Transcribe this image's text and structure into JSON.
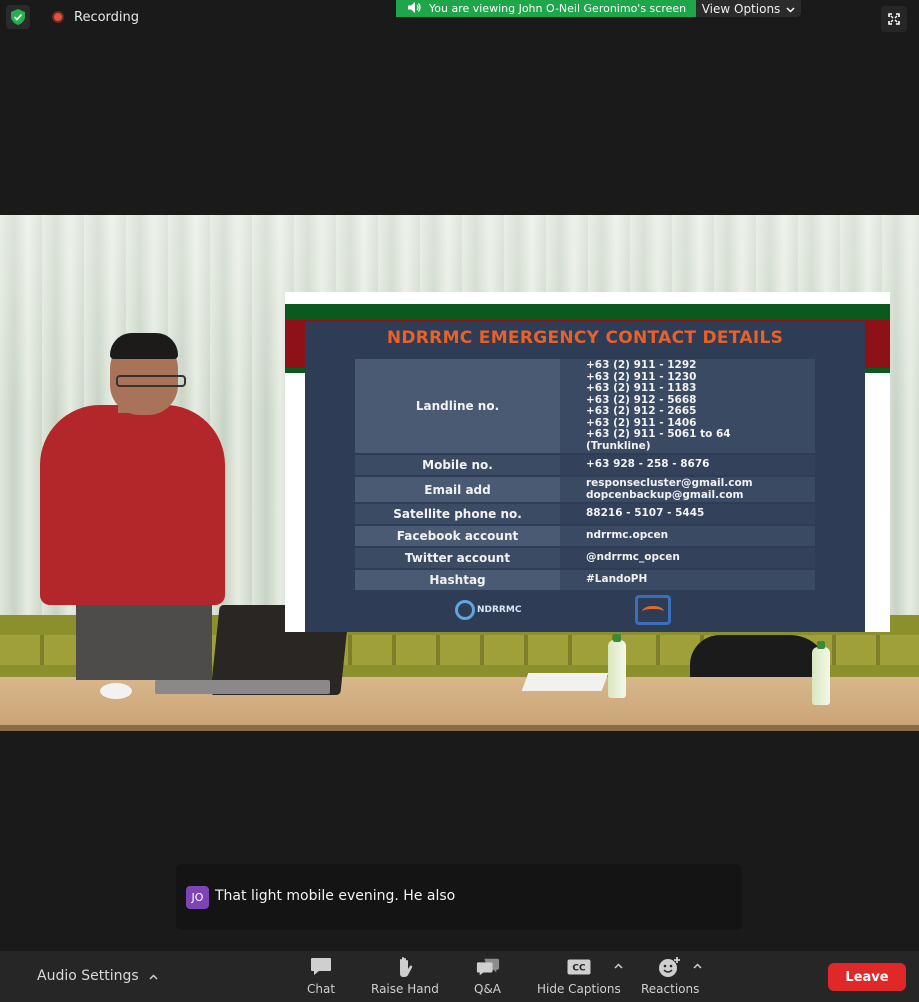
{
  "top_bar": {
    "recording_label": "Recording",
    "banner_text": "You are viewing John O-Neil Geronimo's screen",
    "view_options_label": "View Options",
    "colors": {
      "banner": "#1fa54a",
      "record_dot": "#e2533c",
      "shield": "#22b14c"
    }
  },
  "slide": {
    "title": "NDRRMC EMERGENCY CONTACT DETAILS",
    "rows": [
      {
        "label": "Landline no.",
        "values": [
          "+63 (2) 911 - 1292",
          "+63 (2) 911 - 1230",
          "+63 (2) 911 - 1183",
          "+63 (2) 912 - 5668",
          "+63 (2) 912 - 2665",
          "+63 (2) 911 - 1406",
          "+63 (2) 911 - 5061 to 64",
          "(Trunkline)"
        ]
      },
      {
        "label": "Mobile no.",
        "values": [
          "+63 928 - 258 - 8676"
        ]
      },
      {
        "label": "Email add",
        "values": [
          "responsecluster@gmail.com",
          "dopcenbackup@gmail.com"
        ]
      },
      {
        "label": "Satellite phone no.",
        "values": [
          "88216 - 5107 - 5445"
        ]
      },
      {
        "label": "Facebook account",
        "values": [
          "ndrrmc.opcen"
        ]
      },
      {
        "label": "Twitter account",
        "values": [
          "@ndrrmc_opcen"
        ]
      },
      {
        "label": "Hashtag",
        "values": [
          "#LandoPH"
        ]
      }
    ],
    "logo1_text": "NDRRMC",
    "colors": {
      "title": "#e8602a",
      "panel": "#2e3d55"
    }
  },
  "captions": {
    "speaker_initials": "JO",
    "text": "That light mobile evening. He also"
  },
  "toolbar": {
    "audio_settings_label": "Audio Settings",
    "chat_label": "Chat",
    "raise_hand_label": "Raise Hand",
    "qa_label": "Q&A",
    "hide_captions_label": "Hide Captions",
    "reactions_label": "Reactions",
    "leave_label": "Leave",
    "leave_color": "#e02828"
  }
}
